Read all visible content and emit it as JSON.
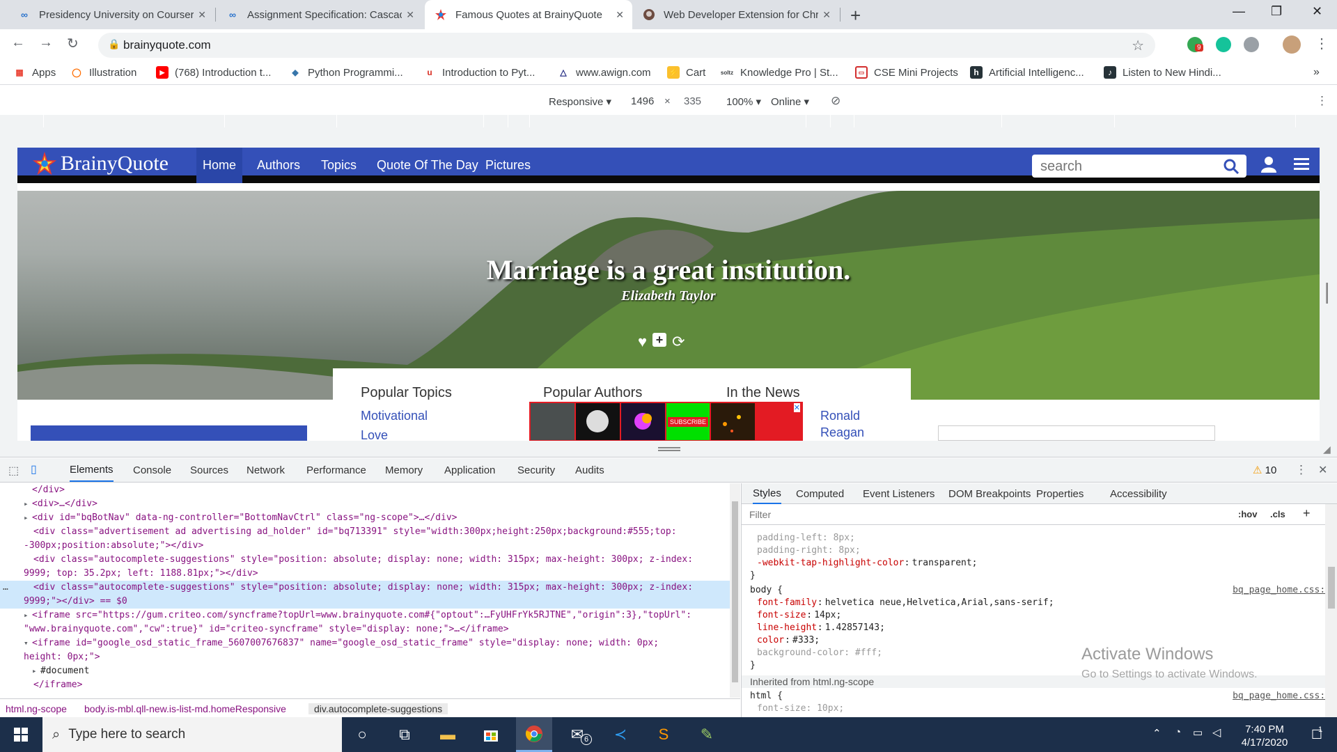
{
  "browser": {
    "tabs": [
      {
        "title": "Presidency University on Courser",
        "icon": "coursera-icon"
      },
      {
        "title": "Assignment Specification: Cascac",
        "icon": "coursera-icon"
      },
      {
        "title": "Famous Quotes at BrainyQuote",
        "icon": "brainyquote-icon",
        "active": true
      },
      {
        "title": "Web Developer Extension for Chr",
        "icon": "extension-icon"
      }
    ],
    "url": "brainyquote.com",
    "bookmarks": [
      {
        "label": "Apps"
      },
      {
        "label": "Illustration"
      },
      {
        "label": "(768) Introduction t..."
      },
      {
        "label": "Python Programmi..."
      },
      {
        "label": "Introduction to Pyt..."
      },
      {
        "label": "www.awign.com"
      },
      {
        "label": "Cart"
      },
      {
        "label": "Knowledge Pro | St..."
      },
      {
        "label": "CSE Mini Projects"
      },
      {
        "label": "Artificial Intelligenc..."
      },
      {
        "label": "Listen to New Hindi..."
      }
    ],
    "extension_badge": "9"
  },
  "device_toolbar": {
    "mode": "Responsive",
    "width": "1496",
    "height": "335",
    "zoom": "100%",
    "throttle": "Online"
  },
  "site": {
    "logo": "BrainyQuote",
    "nav": [
      "Home",
      "Authors",
      "Topics",
      "Quote Of The Day",
      "Pictures"
    ],
    "search_placeholder": "search",
    "quote": "Marriage is a great institution.",
    "author": "Elizabeth Taylor",
    "popular_topics_heading": "Popular Topics",
    "popular_topics": [
      "Motivational",
      "Love"
    ],
    "popular_authors_heading": "Popular Authors",
    "in_the_news_heading": "In the News",
    "in_the_news": [
      "Ronald",
      "Reagan"
    ],
    "ad_subscribe": "SUBSCRIBE",
    "ad_close": "✕"
  },
  "devtools": {
    "tabs": [
      "Elements",
      "Console",
      "Sources",
      "Network",
      "Performance",
      "Memory",
      "Application",
      "Security",
      "Audits"
    ],
    "warnings": "10",
    "styles_tabs": [
      "Styles",
      "Computed",
      "Event Listeners",
      "DOM Breakpoints",
      "Properties",
      "Accessibility"
    ],
    "filter_placeholder": "Filter",
    "hov": ":hov",
    "cls": ".cls",
    "dom_lines": [
      "</div>",
      "<div>…</div>",
      "<div id=\"bqBotNav\" data-ng-controller=\"BottomNavCtrl\" class=\"ng-scope\">…</div>",
      "<div class=\"advertisement ad advertising ad_holder\" id=\"bq713391\" style=\"width:300px;height:250px;background:#555;top:",
      "-300px;position:absolute;\"></div>",
      "<div class=\"autocomplete-suggestions\" style=\"position: absolute; display: none; width: 315px; max-height: 300px; z-index:",
      "9999; top: 35.2px; left: 1188.81px;\"></div>",
      "<div class=\"autocomplete-suggestions\" style=\"position: absolute; display: none; width: 315px; max-height: 300px; z-index:",
      "9999;\"></div> == $0",
      "<iframe src=\"https://gum.criteo.com/syncframe?topUrl=www.brainyquote.com#{\"optout\":…FyUHFrYk5RJTNE\",\"origin\":3},\"topUrl\":",
      "\"www.brainyquote.com\",\"cw\":true}\" id=\"criteo-syncframe\" style=\"display: none;\">…</iframe>",
      "<iframe id=\"google_osd_static_frame_5607007676837\" name=\"google_osd_static_frame\" style=\"display: none; width: 0px;",
      "height: 0px;\">",
      "#document",
      "</iframe>"
    ],
    "breadcrumbs": [
      "html.ng-scope",
      "body.is-mbl.qll-new.is-list-md.homeResponsive",
      "div.autocomplete-suggestions"
    ],
    "css_lines": [
      {
        "text": "padding-left: 8px;",
        "dim": true
      },
      {
        "text": "padding-right: 8px;",
        "dim": true
      },
      {
        "prop": "-webkit-tap-highlight-color",
        "val": "transparent;"
      },
      {
        "text": "}"
      },
      {
        "text": "body {",
        "src": "bq_page_home.css:4"
      },
      {
        "prop": "font-family",
        "val": "helvetica neue,Helvetica,Arial,sans-serif;"
      },
      {
        "prop": "font-size",
        "val": "14px;"
      },
      {
        "prop": "line-height",
        "val": "1.42857143;"
      },
      {
        "prop": "color",
        "val": "#333;"
      },
      {
        "text": "background-color: #fff;",
        "dim": true
      },
      {
        "text": "}"
      },
      {
        "text": "Inherited from html.ng-scope",
        "inherited": true
      },
      {
        "text": "html {",
        "src": "bq_page_home.css:4"
      },
      {
        "text": "font-size: 10px;",
        "dim": true
      }
    ]
  },
  "windows": {
    "activate_title": "Activate Windows",
    "activate_sub": "Go to Settings to activate Windows.",
    "search_placeholder": "Type here to search",
    "time": "7:40 PM",
    "date": "4/17/2020",
    "mail_badge": "6",
    "notif_count": "1"
  },
  "colors": {
    "brand_blue": "#3450b8",
    "devtools_selected": "#cfe8fc",
    "taskbar": "#1c2f4a"
  }
}
